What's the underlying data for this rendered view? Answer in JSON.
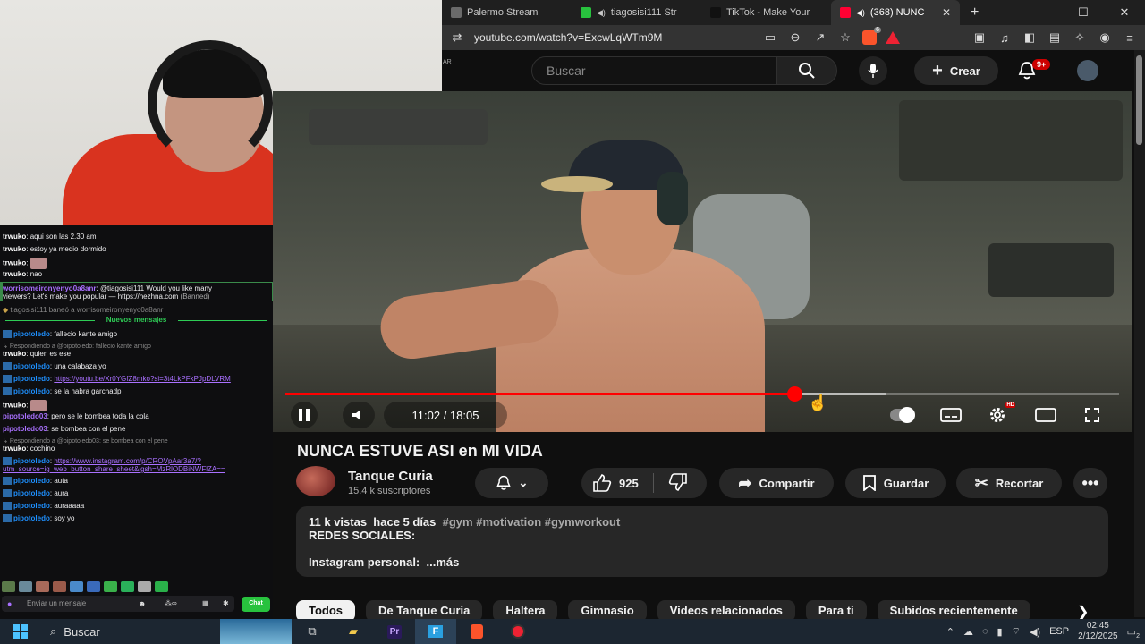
{
  "browser": {
    "tabs": [
      {
        "title": "Palermo Stream",
        "color": "#6a6a6a"
      },
      {
        "title": "tiagosisi111 Str",
        "color": "#28c23e",
        "muted": true
      },
      {
        "title": "TikTok - Make Your",
        "color": "#111111"
      },
      {
        "title": "(368) NUNC",
        "color": "#ff0033",
        "active": true
      }
    ],
    "url": "youtube.com/watch?v=ExcwLqWTm9M",
    "brave_badge": "6",
    "alert_badge": "1"
  },
  "youtube": {
    "search_placeholder": "Buscar",
    "create_label": "Crear",
    "notifications": "9+",
    "corner_text": "AR",
    "player": {
      "time_display": "11:02 / 18:05",
      "progress": 0.61,
      "buffered": 0.72,
      "quality_badge": "HD"
    },
    "video": {
      "title": "NUNCA ESTUVE ASI en MI VIDA",
      "channel": "Tanque Curia",
      "subscribers": "15.4 k suscriptores",
      "likes": "925",
      "share_label": "Compartir",
      "save_label": "Guardar",
      "clip_label": "Recortar",
      "views": "11 k vistas",
      "age": "hace 5 días",
      "hashtags": "#gym #motivation #gymworkout",
      "desc_line1": "REDES SOCIALES:",
      "desc_line2": "Instagram personal:",
      "more_label": "...más"
    },
    "chips": [
      "Todos",
      "De Tanque Curia",
      "Haltera",
      "Gimnasio",
      "Videos relacionados",
      "Para ti",
      "Subidos recientemente"
    ]
  },
  "chat": {
    "messages": [
      {
        "user": "trwuko",
        "text": "aqui son las 2.30 am",
        "color": "#efeff1"
      },
      {
        "user": "trwuko",
        "text": "estoy ya medio dormido",
        "color": "#efeff1"
      },
      {
        "user": "trwuko",
        "text": "",
        "emote": true,
        "color": "#efeff1"
      },
      {
        "user": "trwuko",
        "text": "nao",
        "color": "#efeff1"
      }
    ],
    "spam_user": "worrisomeironyenyo0a8anr",
    "spam_text_1": "@tiagosisi111 Would you like many",
    "spam_text_2": "viewers? Let's make you popular — https://nezhna.com",
    "spam_banned": "(Banned)",
    "mod_action_user": "tiagosisi111",
    "mod_action": "baneó a worrisomeironyenyo0a8anr",
    "new_messages_label": "Nuevos mensajes",
    "messages2": [
      {
        "user": "pipotoledo",
        "text": "fallecio kante amigo",
        "badge": true
      },
      {
        "reply": "Respondiendo a @pipotoledo: fallecio kante amigo"
      },
      {
        "user": "trwuko",
        "text": "quien es ese"
      },
      {
        "user": "pipotoledo",
        "text": "una calabaza yo",
        "badge": true
      },
      {
        "user": "pipotoledo",
        "text": "https://youtu.be/Xr0YGfZ8mko?si=3t4LkPFkPJpDLVRM",
        "badge": true,
        "link": true
      },
      {
        "user": "pipotoledo",
        "text": "se la habra garchadp",
        "badge": true
      },
      {
        "user": "trwuko",
        "text": "",
        "emote": true
      },
      {
        "user": "pipotoledo03",
        "text": "pero se le bombea toda la cola"
      },
      {
        "user": "pipotoledo03",
        "text": "se bombea con el pene"
      },
      {
        "reply": "Respondiendo a @pipotoledo03: se bombea con el pene"
      },
      {
        "user": "trwuko",
        "text": "cochino"
      },
      {
        "user": "pipotoledo",
        "text": "https://www.instagram.com/p/CROVpAar3a7/?",
        "badge": true,
        "link": true
      },
      {
        "cont": "utm_source=ig_web_button_share_sheet&igsh=MzRlODBiNWFlZA=="
      },
      {
        "user": "pipotoledo",
        "text": "auta",
        "badge": true
      },
      {
        "user": "pipotoledo",
        "text": "aura",
        "badge": true
      },
      {
        "user": "pipotoledo",
        "text": "auraaaaa",
        "badge": true
      },
      {
        "user": "pipotoledo",
        "text": "soy yo",
        "badge": true
      }
    ],
    "input_placeholder": "Enviar un mensaje",
    "send_label": "Chat",
    "colors": {
      "trwuko": "#ffffff",
      "pipotoledo": "#1e90ff",
      "pipotoledo03": "#a970ff",
      "spam": "#a970ff"
    }
  },
  "taskbar": {
    "search_label": "Buscar",
    "language": "ESP",
    "time": "02:45",
    "date": "2/12/2025",
    "notif_count": "2"
  }
}
